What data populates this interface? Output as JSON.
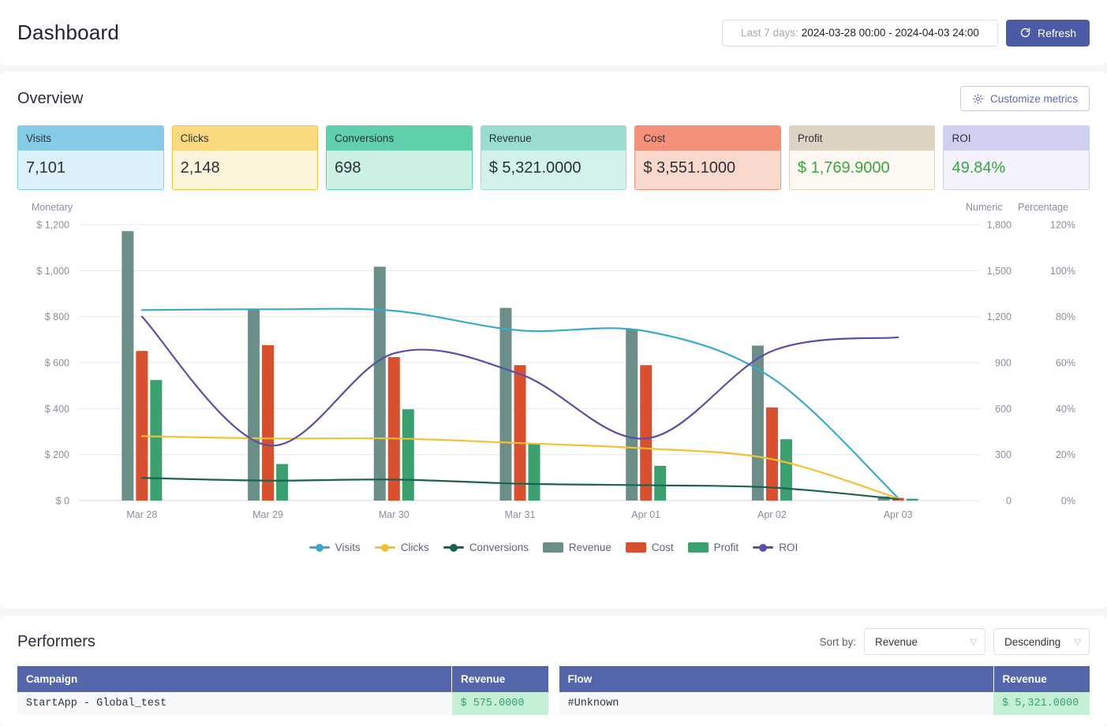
{
  "header": {
    "title": "Dashboard",
    "date_range_label": "Last 7 days:",
    "date_range_value": "2024-03-28 00:00 - 2024-04-03 24:00",
    "refresh_label": "Refresh",
    "refresh_icon": "refresh-icon",
    "accent_color": "#4d5ba6"
  },
  "overview": {
    "title": "Overview",
    "customize_label": "Customize metrics",
    "customize_icon": "gear-icon",
    "metrics": [
      {
        "label": "Visits",
        "value": "7,101",
        "header_bg": "#85cbe6",
        "body_bg": "#ddf1fa",
        "border": "#85cbe6",
        "value_color": "#2c3038"
      },
      {
        "label": "Clicks",
        "value": "2,148",
        "header_bg": "#fbd97e",
        "body_bg": "#fdf4dc",
        "border": "#f0bf49",
        "value_color": "#2c3038"
      },
      {
        "label": "Conversions",
        "value": "698",
        "header_bg": "#5fd0ab",
        "body_bg": "#cdf0e4",
        "border": "#5fd0ab",
        "value_color": "#2c3038"
      },
      {
        "label": "Revenue",
        "value": "$ 5,321.0000",
        "header_bg": "#9bdcd0",
        "body_bg": "#d4f2ec",
        "border": "#9bdcd0",
        "value_color": "#2c3038"
      },
      {
        "label": "Cost",
        "value": "$ 3,551.1000",
        "header_bg": "#f5917a",
        "body_bg": "#fbd8cd",
        "border": "#f5917a",
        "value_color": "#2c3038"
      },
      {
        "label": "Profit",
        "value": "$ 1,769.9000",
        "header_bg": "#ded2c2",
        "body_bg": "#fdf8f2",
        "border": "#ded2c2",
        "value_color": "#3aa63f"
      },
      {
        "label": "ROI",
        "value": "49.84%",
        "header_bg": "#cfcff0",
        "body_bg": "#f4f3fd",
        "border": "#cfcff0",
        "value_color": "#3aa63f"
      }
    ]
  },
  "chart_data": {
    "type": "bar",
    "title": "",
    "xlabel": "",
    "categories": [
      "Mar 28",
      "Mar 29",
      "Mar 30",
      "Mar 31",
      "Apr 01",
      "Apr 02",
      "Apr 03"
    ],
    "axes": {
      "left": {
        "name": "Monetary",
        "ticks": [
          "$ 0",
          "$ 200",
          "$ 400",
          "$ 600",
          "$ 800",
          "$ 1,000",
          "$ 1,200"
        ],
        "min": 0,
        "max": 1200
      },
      "right1": {
        "name": "Numeric",
        "ticks": [
          "0",
          "300",
          "600",
          "900",
          "1,200",
          "1,500",
          "1,800"
        ],
        "min": 0,
        "max": 1800
      },
      "right2": {
        "name": "Percentage",
        "ticks": [
          "0%",
          "20%",
          "40%",
          "60%",
          "80%",
          "100%",
          "120%"
        ],
        "min": 0,
        "max": 120
      }
    },
    "grid": true,
    "legend_position": "bottom",
    "series": [
      {
        "name": "Visits",
        "kind": "line",
        "axis": "right1",
        "color": "#3ba9cc",
        "values": [
          1243,
          1248,
          1238,
          1110,
          1105,
          800,
          18
        ]
      },
      {
        "name": "Clicks",
        "kind": "line",
        "axis": "right1",
        "color": "#f5c032",
        "values": [
          420,
          405,
          405,
          375,
          340,
          270,
          15
        ]
      },
      {
        "name": "Conversions",
        "kind": "line",
        "axis": "right1",
        "color": "#1a6353",
        "values": [
          148,
          130,
          137,
          110,
          100,
          85,
          10
        ]
      },
      {
        "name": "Revenue",
        "kind": "bar",
        "axis": "left",
        "color": "#6c8e88",
        "values": [
          1172,
          834,
          1017,
          838,
          746,
          674,
          18
        ]
      },
      {
        "name": "Cost",
        "kind": "bar",
        "axis": "left",
        "color": "#d8502d",
        "values": [
          651,
          676,
          624,
          589,
          589,
          405,
          12
        ]
      },
      {
        "name": "Profit",
        "kind": "bar",
        "axis": "left",
        "color": "#3aa06e",
        "values": [
          524,
          159,
          397,
          248,
          151,
          267,
          8
        ]
      },
      {
        "name": "ROI",
        "kind": "line",
        "axis": "right2",
        "color": "#5b4ea8",
        "values": [
          80,
          24,
          64,
          55,
          27,
          65,
          71
        ]
      }
    ]
  },
  "performers": {
    "title": "Performers",
    "sort_by_label": "Sort by:",
    "sort_by_value": "Revenue",
    "sort_dir_value": "Descending",
    "chevron_icon": "chevron-down-icon",
    "campaign_table": {
      "columns": [
        "Campaign",
        "Revenue"
      ],
      "rows": [
        [
          "StartApp - Global_test",
          "$ 575.0000"
        ]
      ]
    },
    "flow_table": {
      "columns": [
        "Flow",
        "Revenue"
      ],
      "rows": [
        [
          "#Unknown",
          "$ 5,321.0000"
        ]
      ]
    }
  }
}
